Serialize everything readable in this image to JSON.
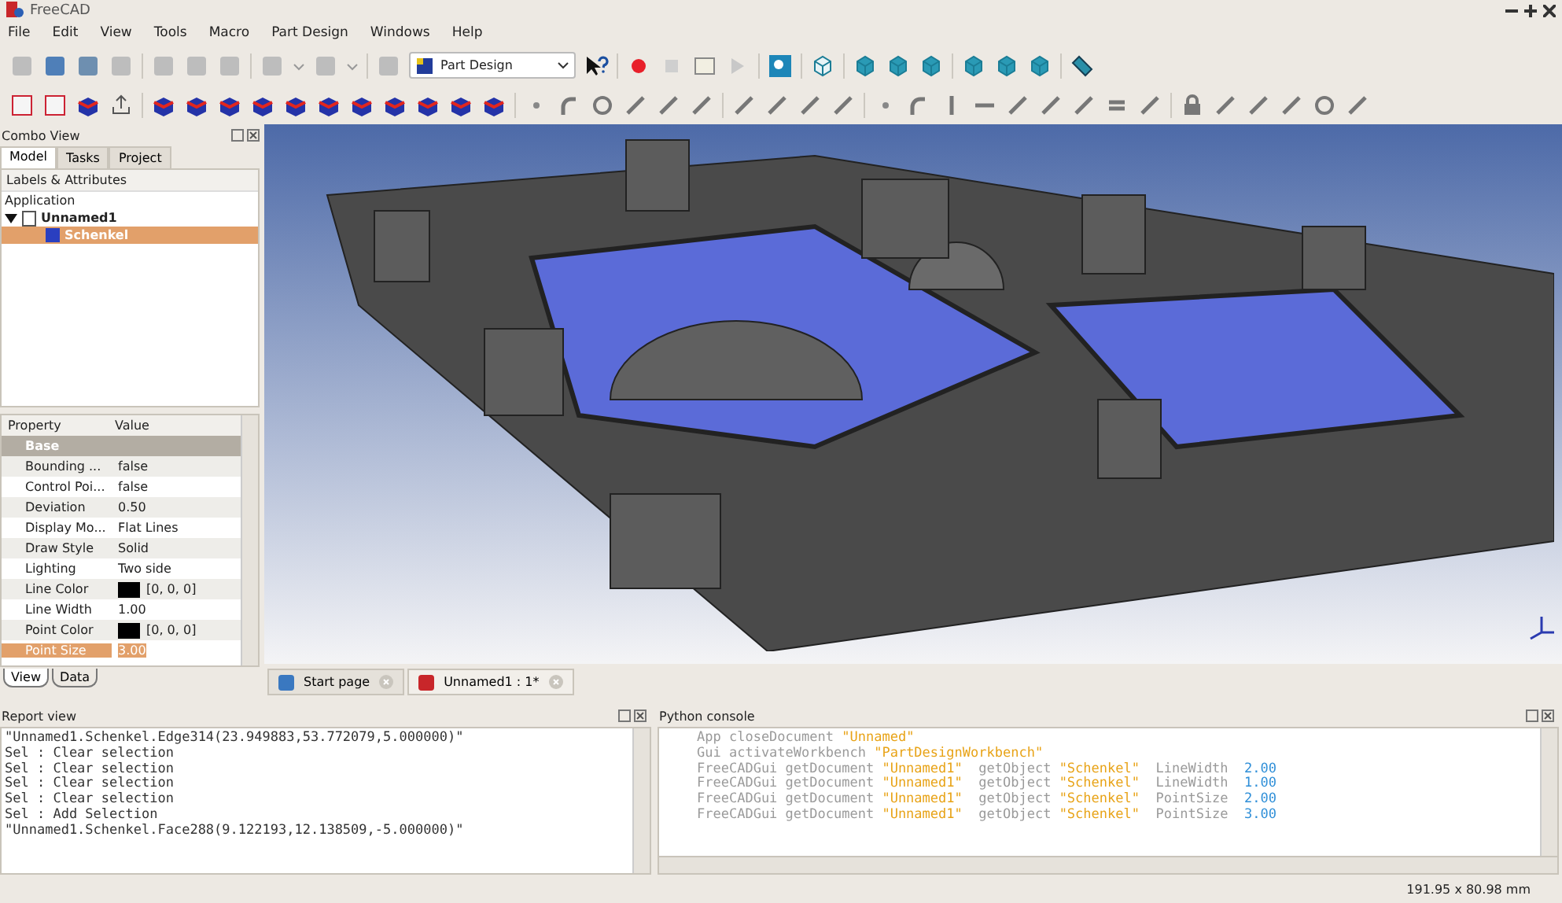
{
  "window": {
    "title": "FreeCAD"
  },
  "menu": [
    "File",
    "Edit",
    "View",
    "Tools",
    "Macro",
    "Part Design",
    "Windows",
    "Help"
  ],
  "workbench": {
    "value": "Part Design"
  },
  "combo_view": {
    "title": "Combo View",
    "tabs": [
      {
        "label": "Model",
        "selected": true
      },
      {
        "label": "Tasks",
        "selected": false
      },
      {
        "label": "Project",
        "selected": false
      }
    ],
    "tree": {
      "header": "Labels & Attributes",
      "root": "Application",
      "items": [
        {
          "label": "Unnamed1",
          "expanded": true,
          "selected": false,
          "children": [
            {
              "label": "Schenkel",
              "selected": true
            }
          ]
        }
      ]
    },
    "properties": {
      "columns": [
        "Property",
        "Value"
      ],
      "group": "Base",
      "rows": [
        {
          "name": "Bounding ...",
          "value": "false",
          "selected": false
        },
        {
          "name": "Control Poi...",
          "value": "false",
          "selected": false
        },
        {
          "name": "Deviation",
          "value": "0.50",
          "selected": false
        },
        {
          "name": "Display Mo...",
          "value": "Flat Lines",
          "selected": false
        },
        {
          "name": "Draw Style",
          "value": "Solid",
          "selected": false
        },
        {
          "name": "Lighting",
          "value": "Two side",
          "selected": false
        },
        {
          "name": "Line Color",
          "value": "[0, 0, 0]",
          "color": "#000000",
          "selected": false
        },
        {
          "name": "Line Width",
          "value": "1.00",
          "selected": false
        },
        {
          "name": "Point Color",
          "value": "[0, 0, 0]",
          "color": "#000000",
          "selected": false
        },
        {
          "name": "Point Size",
          "value": "3.00",
          "selected": true
        }
      ]
    },
    "bottom_tabs": [
      {
        "label": "View",
        "selected": true
      },
      {
        "label": "Data",
        "selected": false
      }
    ]
  },
  "doc_tabs": [
    {
      "label": "Start page",
      "selected": false
    },
    {
      "label": "Unnamed1 : 1*",
      "selected": true
    }
  ],
  "report_view": {
    "title": "Report view",
    "lines": [
      "\"Unnamed1.Schenkel.Edge314(23.949883,53.772079,5.000000)\"",
      "Sel : Clear selection",
      "Sel : Clear selection",
      "Sel : Clear selection",
      "Sel : Clear selection",
      "Sel : Add Selection",
      "\"Unnamed1.Schenkel.Face288(9.122193,12.138509,-5.000000)\""
    ]
  },
  "python_console": {
    "title": "Python console",
    "lines": [
      [
        {
          "text": "App closeDocument ",
          "kind": "code"
        },
        {
          "text": "\"Unnamed\"",
          "kind": "string"
        }
      ],
      [
        {
          "text": "Gui activateWorkbench ",
          "kind": "code"
        },
        {
          "text": "\"PartDesignWorkbench\"",
          "kind": "string"
        }
      ],
      [
        {
          "text": "FreeCADGui getDocument ",
          "kind": "code"
        },
        {
          "text": "\"Unnamed1\"",
          "kind": "string"
        },
        {
          "text": "  getObject ",
          "kind": "code"
        },
        {
          "text": "\"Schenkel\"",
          "kind": "string"
        },
        {
          "text": "  LineWidth  ",
          "kind": "code"
        },
        {
          "text": "2.00",
          "kind": "number"
        }
      ],
      [
        {
          "text": "FreeCADGui getDocument ",
          "kind": "code"
        },
        {
          "text": "\"Unnamed1\"",
          "kind": "string"
        },
        {
          "text": "  getObject ",
          "kind": "code"
        },
        {
          "text": "\"Schenkel\"",
          "kind": "string"
        },
        {
          "text": "  LineWidth  ",
          "kind": "code"
        },
        {
          "text": "1.00",
          "kind": "number"
        }
      ],
      [
        {
          "text": "FreeCADGui getDocument ",
          "kind": "code"
        },
        {
          "text": "\"Unnamed1\"",
          "kind": "string"
        },
        {
          "text": "  getObject ",
          "kind": "code"
        },
        {
          "text": "\"Schenkel\"",
          "kind": "string"
        },
        {
          "text": "  PointSize  ",
          "kind": "code"
        },
        {
          "text": "2.00",
          "kind": "number"
        }
      ],
      [
        {
          "text": "FreeCADGui getDocument ",
          "kind": "code"
        },
        {
          "text": "\"Unnamed1\"",
          "kind": "string"
        },
        {
          "text": "  getObject ",
          "kind": "code"
        },
        {
          "text": "\"Schenkel\"",
          "kind": "string"
        },
        {
          "text": "  PointSize  ",
          "kind": "code"
        },
        {
          "text": "3.00",
          "kind": "number"
        }
      ]
    ]
  },
  "status_bar": {
    "dimensions": "191.95 x 80.98 mm"
  }
}
